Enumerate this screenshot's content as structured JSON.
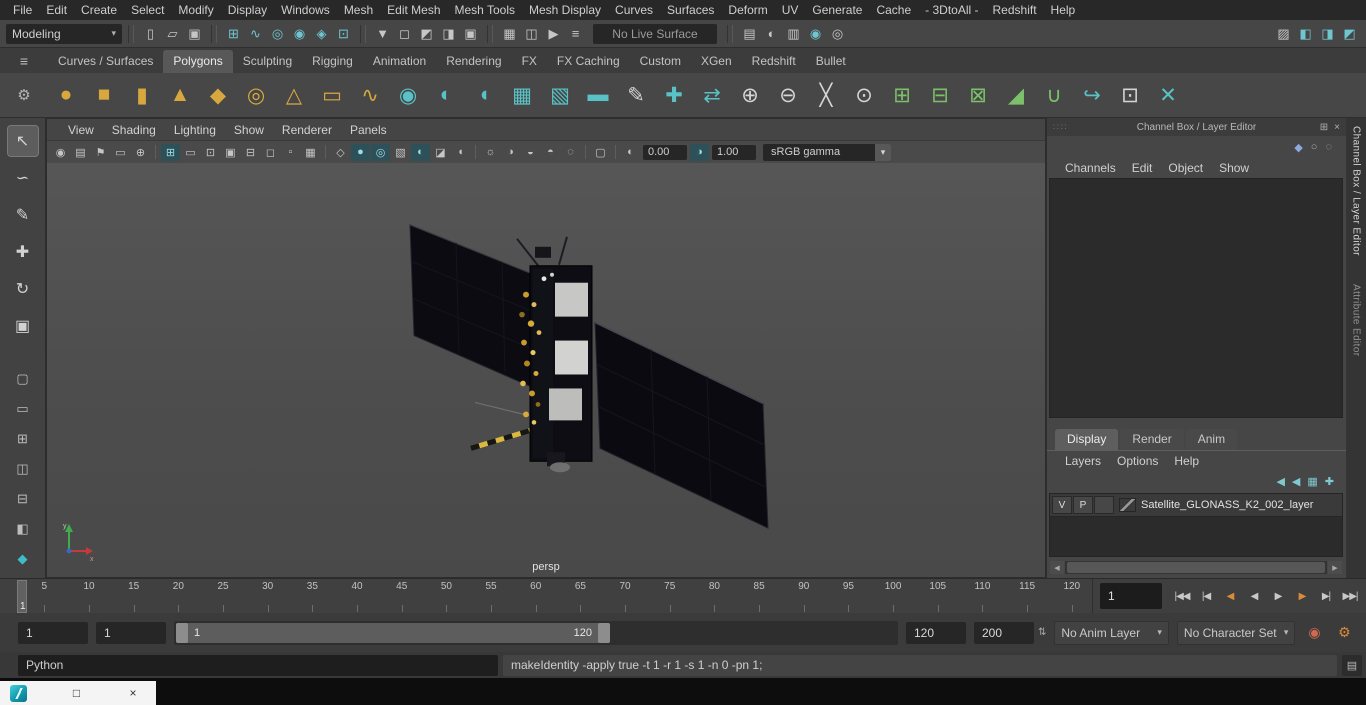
{
  "colors": {
    "accent_teal": "#59c2c6",
    "shelf_gold": "#d8a73e",
    "shelf_green": "#7cc06a",
    "key_orange": "#d98a3a",
    "viewport_bg": "#4d4d4d"
  },
  "glyphs": {
    "caret_down": "▾",
    "hamburger": "≡",
    "gear": "⚙",
    "close": "×",
    "dock": "⊞",
    "handle": "∷∷",
    "exposure": "◐",
    "gamma": "◑",
    "left_arrow": "◀",
    "right_arrow": "▶",
    "script_editor": "▤",
    "auto_key": "◉",
    "prefs_gear": "⚙",
    "spinner": "⇅",
    "restore": "□"
  },
  "menubar": [
    "File",
    "Edit",
    "Create",
    "Select",
    "Modify",
    "Display",
    "Windows",
    "Mesh",
    "Edit Mesh",
    "Mesh Tools",
    "Mesh Display",
    "Curves",
    "Surfaces",
    "Deform",
    "UV",
    "Generate",
    "Cache",
    "- 3DtoAll -",
    "Redshift",
    "Help"
  ],
  "statusline": {
    "mode": "Modeling",
    "live_surface": "No Live Surface",
    "file_icons": [
      {
        "name": "new-scene-icon",
        "glyph": "▯"
      },
      {
        "name": "open-scene-icon",
        "glyph": "▱"
      },
      {
        "name": "save-scene-icon",
        "glyph": "▣"
      }
    ],
    "snap_icons": [
      {
        "name": "snap-to-grid-icon",
        "glyph": "⊞",
        "color": "#6fc6d0"
      },
      {
        "name": "snap-to-curve-icon",
        "glyph": "∿",
        "color": "#6fc6d0"
      },
      {
        "name": "snap-to-point-icon",
        "glyph": "◎",
        "color": "#6fc6d0"
      },
      {
        "name": "snap-to-projected-center-icon",
        "glyph": "◉",
        "color": "#6fc6d0"
      },
      {
        "name": "make-live-icon",
        "glyph": "◈",
        "color": "#6fc6d0"
      },
      {
        "name": "snap-to-view-plane-icon",
        "glyph": "⊡",
        "color": "#6fc6d0"
      }
    ],
    "selection_icons": [
      {
        "name": "select-hierarchy-icon",
        "glyph": "▼"
      },
      {
        "name": "select-object-icon",
        "glyph": "◻"
      },
      {
        "name": "select-component-icon",
        "glyph": "◩"
      },
      {
        "name": "highlight-selection-icon",
        "glyph": "◨"
      },
      {
        "name": "lock-selection-icon",
        "glyph": "▣"
      }
    ],
    "history_icons": [
      {
        "name": "construction-history-icon",
        "glyph": "▦"
      },
      {
        "name": "symmetry-icon",
        "glyph": "◫"
      },
      {
        "name": "evaluation-mode-icon",
        "glyph": "▶"
      },
      {
        "name": "frame-rate-display-icon",
        "glyph": "≡"
      }
    ],
    "render_icons": [
      {
        "name": "render-current-frame-icon",
        "glyph": "▤"
      },
      {
        "name": "ipr-render-icon",
        "glyph": "◐"
      },
      {
        "name": "render-settings-icon",
        "glyph": "▥"
      },
      {
        "name": "render-view-icon",
        "glyph": "◉",
        "color": "#6fc6d0"
      },
      {
        "name": "hypershade-icon",
        "glyph": "◎"
      }
    ],
    "panel_toggle_icons": [
      {
        "name": "toggle-modeling-toolkit-icon",
        "glyph": "▨"
      },
      {
        "name": "toggle-attribute-editor-icon",
        "glyph": "◧",
        "color": "#6fc6d0"
      },
      {
        "name": "toggle-tool-settings-icon",
        "glyph": "◨",
        "color": "#6fc6d0"
      },
      {
        "name": "toggle-channel-box-icon",
        "glyph": "◩",
        "color": "#6fc6d0"
      }
    ]
  },
  "shelf": {
    "tabs": [
      "Curves / Surfaces",
      {
        "label": "Polygons",
        "active": true
      },
      "Sculpting",
      "Rigging",
      "Animation",
      "Rendering",
      "FX",
      "FX Caching",
      "Custom",
      "XGen",
      "Redshift",
      "Bullet"
    ],
    "icons": [
      {
        "name": "poly-sphere-icon",
        "glyph": "●",
        "color": "#d8a73e"
      },
      {
        "name": "poly-cube-icon",
        "glyph": "■",
        "color": "#d8a73e"
      },
      {
        "name": "poly-cylinder-icon",
        "glyph": "▮",
        "color": "#d8a73e"
      },
      {
        "name": "poly-cone-icon",
        "glyph": "▲",
        "color": "#d8a73e"
      },
      {
        "name": "poly-platonic-icon",
        "glyph": "◆",
        "color": "#d8a73e"
      },
      {
        "name": "poly-torus-icon",
        "glyph": "◎",
        "color": "#d8a73e"
      },
      {
        "name": "poly-pyramid-icon",
        "glyph": "△",
        "color": "#d8a73e"
      },
      {
        "name": "poly-pipe-icon",
        "glyph": "▭",
        "color": "#d8a73e"
      },
      {
        "name": "poly-helix-icon",
        "glyph": "∿",
        "color": "#d8a73e"
      },
      {
        "name": "smooth-mesh-icon",
        "glyph": "◉",
        "color": "#59c2c6"
      },
      {
        "name": "subdiv-proxy-icon",
        "glyph": "◐",
        "color": "#59c2c6"
      },
      {
        "name": "sculpt-tool-icon",
        "glyph": "◖",
        "color": "#59c2c6"
      },
      {
        "name": "poly-grid-icon",
        "glyph": "▦",
        "color": "#59c2c6"
      },
      {
        "name": "textured-mode-icon",
        "glyph": "▧",
        "color": "#59c2c6"
      },
      {
        "name": "poly-plane-icon",
        "glyph": "▬",
        "color": "#59c2c6"
      },
      {
        "name": "create-polygon-tool-icon",
        "glyph": "✎",
        "color": "#d5d5d5"
      },
      {
        "name": "quad-draw-icon",
        "glyph": "✚",
        "color": "#59c2c6"
      },
      {
        "name": "mirror-icon",
        "glyph": "⇄",
        "color": "#59c2c6"
      },
      {
        "name": "combine-icon",
        "glyph": "⊕",
        "color": "#d5d5d5"
      },
      {
        "name": "separate-icon",
        "glyph": "⊖",
        "color": "#d5d5d5"
      },
      {
        "name": "multi-cut-icon",
        "glyph": "╳",
        "color": "#d5d5d5"
      },
      {
        "name": "target-weld-icon",
        "glyph": "⊙",
        "color": "#d5d5d5"
      },
      {
        "name": "boolean-union-icon",
        "glyph": "⊞",
        "color": "#7cc06a"
      },
      {
        "name": "boolean-difference-icon",
        "glyph": "⊟",
        "color": "#7cc06a"
      },
      {
        "name": "boolean-intersection-icon",
        "glyph": "⊠",
        "color": "#7cc06a"
      },
      {
        "name": "bevel-icon",
        "glyph": "◢",
        "color": "#7cc06a"
      },
      {
        "name": "bridge-icon",
        "glyph": "∪",
        "color": "#7cc06a"
      },
      {
        "name": "curve-warp-icon",
        "glyph": "↪",
        "color": "#59c2c6"
      },
      {
        "name": "extrude-icon",
        "glyph": "⊡",
        "color": "#d5d5d5"
      },
      {
        "name": "mesh-cleanup-icon",
        "glyph": "✕",
        "color": "#59c2c6"
      }
    ]
  },
  "toolbox": {
    "tools": [
      {
        "name": "select-tool",
        "glyph": "↖",
        "active": true
      },
      {
        "name": "lasso-select-tool",
        "glyph": "∽"
      },
      {
        "name": "paint-select-tool",
        "glyph": "✎"
      },
      {
        "name": "move-tool",
        "glyph": "✚"
      },
      {
        "name": "rotate-tool",
        "glyph": "↻"
      },
      {
        "name": "scale-tool",
        "glyph": "▣"
      }
    ],
    "layouts": [
      {
        "name": "last-tool-slot",
        "glyph": "▢"
      },
      {
        "name": "layout-single-pane-button",
        "glyph": "▭"
      },
      {
        "name": "layout-four-pane-button",
        "glyph": "⊞"
      },
      {
        "name": "layout-two-pane-side-button",
        "glyph": "◫"
      },
      {
        "name": "layout-two-pane-stacked-button",
        "glyph": "⊟"
      },
      {
        "name": "layout-persp-outliner-button",
        "glyph": "◧"
      },
      {
        "name": "layout-custom-button",
        "glyph": "◆",
        "color": "#3fbdc7"
      }
    ]
  },
  "viewport": {
    "menu": [
      "View",
      "Shading",
      "Lighting",
      "Show",
      "Renderer",
      "Panels"
    ],
    "toolbar": {
      "camera_group": [
        {
          "name": "select-camera-icon",
          "glyph": "◉"
        },
        {
          "name": "camera-attributes-icon",
          "glyph": "▤"
        },
        {
          "name": "bookmark-icon",
          "glyph": "⚑"
        },
        {
          "name": "image-plane-icon",
          "glyph": "▭"
        },
        {
          "name": "two-d-pan-zoom-icon",
          "glyph": "⊕"
        }
      ],
      "gate_group": [
        {
          "name": "grid-icon",
          "glyph": "⊞",
          "active": true
        },
        {
          "name": "film-gate-icon",
          "glyph": "▭"
        },
        {
          "name": "resolution-gate-icon",
          "glyph": "⊡"
        },
        {
          "name": "gate-mask-icon",
          "glyph": "▣"
        },
        {
          "name": "field-chart-icon",
          "glyph": "⊟"
        },
        {
          "name": "safe-action-icon",
          "glyph": "◻"
        },
        {
          "name": "safe-title-icon",
          "glyph": "▫"
        },
        {
          "name": "camera-sequencer-icon",
          "glyph": "▦"
        }
      ],
      "shading_group": [
        {
          "name": "wireframe-icon",
          "glyph": "◇"
        },
        {
          "name": "smooth-shade-icon",
          "glyph": "●",
          "active": true
        },
        {
          "name": "wireframe-on-shaded-icon",
          "glyph": "◎",
          "active": true
        },
        {
          "name": "textured-icon",
          "glyph": "▧"
        },
        {
          "name": "use-default-material-icon",
          "glyph": "◐",
          "active": true
        },
        {
          "name": "xray-icon",
          "glyph": "◪"
        },
        {
          "name": "backface-culling-icon",
          "glyph": "◖"
        }
      ],
      "lighting_group": [
        {
          "name": "use-all-lights-icon",
          "glyph": "☼"
        },
        {
          "name": "shadows-icon",
          "glyph": "◑"
        },
        {
          "name": "screen-space-ao-icon",
          "glyph": "◒"
        },
        {
          "name": "motion-blur-icon",
          "glyph": "◓"
        },
        {
          "name": "anti-aliasing-icon",
          "glyph": "◌"
        }
      ],
      "isolate_group": [
        {
          "name": "isolate-select-icon",
          "glyph": "▢"
        }
      ]
    },
    "exposure": "0.00",
    "gamma": "1.00",
    "view_transform": "sRGB gamma",
    "camera_label": "persp",
    "axis": {
      "x": "x",
      "y": "y"
    }
  },
  "channel_box": {
    "title": "Channel Box / Layer Editor",
    "menu": [
      "Channels",
      "Edit",
      "Object",
      "Show"
    ],
    "corner_icons": [
      {
        "name": "pin-channel-box-icon",
        "glyph": "◆",
        "color": "#8fa8e0"
      },
      {
        "name": "slider-speed-icon",
        "glyph": "○"
      },
      {
        "name": "manip-mode-icon",
        "glyph": "◌"
      }
    ]
  },
  "layer_editor": {
    "tabs": [
      {
        "label": "Display",
        "active": true
      },
      {
        "label": "Render"
      },
      {
        "label": "Anim"
      }
    ],
    "menu": [
      "Layers",
      "Options",
      "Help"
    ],
    "toolbar_icons": [
      {
        "name": "layer-move-up-icon",
        "glyph": "◀",
        "color": "#7fc9d1"
      },
      {
        "name": "layer-move-down-icon",
        "glyph": "◀",
        "color": "#7fc9d1"
      },
      {
        "name": "create-layer-from-selected-icon",
        "glyph": "▦",
        "color": "#7fc9d1"
      },
      {
        "name": "create-empty-layer-icon",
        "glyph": "✚",
        "color": "#7fc9d1"
      }
    ],
    "layer": {
      "visibility": "V",
      "playback": "P",
      "name": "Satellite_GLONASS_K2_002_layer"
    }
  },
  "side_tabs": [
    {
      "label": "Channel Box / Layer Editor",
      "active": true
    },
    {
      "label": "Attribute Editor"
    }
  ],
  "timeline": {
    "ticks": [
      "5",
      "10",
      "15",
      "20",
      "25",
      "30",
      "35",
      "40",
      "45",
      "50",
      "55",
      "60",
      "65",
      "70",
      "75",
      "80",
      "85",
      "90",
      "95",
      "100",
      "105",
      "110",
      "115",
      "120"
    ],
    "current_frame": "1",
    "frame_field": "1"
  },
  "playback": [
    {
      "name": "go-to-start-button",
      "glyph": "|◀◀"
    },
    {
      "name": "step-back-frame-button",
      "glyph": "|◀"
    },
    {
      "name": "step-back-key-button",
      "glyph": "◀",
      "color": "#d98a3a"
    },
    {
      "name": "play-backwards-button",
      "glyph": "◀"
    },
    {
      "name": "play-forwards-button",
      "glyph": "▶"
    },
    {
      "name": "step-forward-key-button",
      "glyph": "▶",
      "color": "#d98a3a"
    },
    {
      "name": "step-forward-frame-button",
      "glyph": "▶|"
    },
    {
      "name": "go-to-end-button",
      "glyph": "▶▶|"
    }
  ],
  "range_slider": {
    "animation_start": "1",
    "playback_start": "1",
    "range_start": "1",
    "range_end": "120",
    "playback_end": "120",
    "animation_end": "200",
    "anim_layer": "No Anim Layer",
    "character_set": "No Character Set"
  },
  "command_line": {
    "language": "Python",
    "help_line": "makeIdentity -apply true -t 1 -r 1 -s 1 -n 0 -pn 1;"
  },
  "taskbar": {}
}
